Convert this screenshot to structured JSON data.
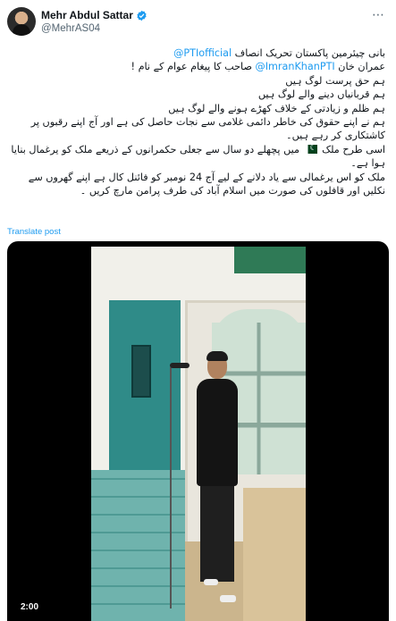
{
  "author": {
    "display_name": "Mehr Abdul Sattar",
    "handle": "@MehrAS04",
    "verified": true
  },
  "post": {
    "lines": [
      {
        "mention": "@PTIofficial",
        "text": "بانی چیئرمین پاکستان تحریک انصاف "
      },
      {
        "mention": "@ImranKhanPTI",
        "text": "عمران خان ",
        "text_after": " صاحب کا پیغام عوام کے نام !"
      },
      {
        "text": "ہم حق پرست لوگ ہیں"
      },
      {
        "text": "ہم قربانیاں دینے والے لوگ ہیں"
      },
      {
        "text": "ہم ظلم و زیادتی کے خلاف کھڑے ہونے والے لوگ ہیں"
      },
      {
        "text": "ہم نے اپنے حقوق کی خاطر دائمی غلامی سے نجات حاصل کی ہے اور آج اپنے رقبوں پر کاشتکاری کر رہے ہیں۔"
      },
      {
        "text": "اسی طرح ملک ",
        "flag": "pakistan-flag",
        "text_after": " میں پچھلے دو سال سے جعلی حکمرانوں کے ذریعے ملک کو یرغمال بنایا ہوا ہے۔"
      },
      {
        "text": "ملک کو اس یرغمالی سے یاد دلانے کے لیے آج 24 نومبر کو فائنل کال ہے اپنے گھروں سے نکلیں اور قافلوں کی صورت میں اسلام آباد کی طرف پرامن مارچ کریں ۔"
      }
    ],
    "translate_label": "Translate post"
  },
  "video": {
    "duration": "2:00"
  },
  "icons": {
    "verified": "verified-badge-icon",
    "more": "more-options-icon"
  },
  "colors": {
    "link": "#1d9bf0",
    "verified": "#1d9bf0",
    "secondary_text": "#536471"
  }
}
